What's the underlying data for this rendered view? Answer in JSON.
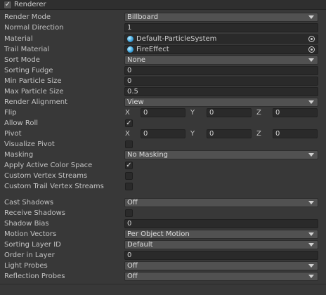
{
  "header": {
    "title": "Renderer",
    "enabled": "✓"
  },
  "fields": {
    "render_mode": {
      "label": "Render Mode",
      "value": "Billboard"
    },
    "normal_direction": {
      "label": "Normal Direction",
      "value": "1"
    },
    "material": {
      "label": "Material",
      "value": "Default-ParticleSystem"
    },
    "trail_material": {
      "label": "Trail Material",
      "value": "FireEffect"
    },
    "sort_mode": {
      "label": "Sort Mode",
      "value": "None"
    },
    "sorting_fudge": {
      "label": "Sorting Fudge",
      "value": "0"
    },
    "min_particle_size": {
      "label": "Min Particle Size",
      "value": "0"
    },
    "max_particle_size": {
      "label": "Max Particle Size",
      "value": "0.5"
    },
    "render_alignment": {
      "label": "Render Alignment",
      "value": "View"
    },
    "flip": {
      "label": "Flip",
      "x_label": "X",
      "x": "0",
      "y_label": "Y",
      "y": "0",
      "z_label": "Z",
      "z": "0"
    },
    "allow_roll": {
      "label": "Allow Roll",
      "checked": "✓"
    },
    "pivot": {
      "label": "Pivot",
      "x_label": "X",
      "x": "0",
      "y_label": "Y",
      "y": "0",
      "z_label": "Z",
      "z": "0"
    },
    "visualize_pivot": {
      "label": "Visualize Pivot",
      "checked": ""
    },
    "masking": {
      "label": "Masking",
      "value": "No Masking"
    },
    "apply_active_color_space": {
      "label": "Apply Active Color Space",
      "checked": "✓"
    },
    "custom_vertex_streams": {
      "label": "Custom Vertex Streams",
      "checked": ""
    },
    "custom_trail_vertex_streams": {
      "label": "Custom Trail Vertex Streams",
      "checked": ""
    },
    "cast_shadows": {
      "label": "Cast Shadows",
      "value": "Off"
    },
    "receive_shadows": {
      "label": "Receive Shadows",
      "checked": ""
    },
    "shadow_bias": {
      "label": "Shadow Bias",
      "value": "0"
    },
    "motion_vectors": {
      "label": "Motion Vectors",
      "value": "Per Object Motion"
    },
    "sorting_layer_id": {
      "label": "Sorting Layer ID",
      "value": "Default"
    },
    "order_in_layer": {
      "label": "Order in Layer",
      "value": "0"
    },
    "light_probes": {
      "label": "Light Probes",
      "value": "Off"
    },
    "reflection_probes": {
      "label": "Reflection Probes",
      "value": "Off"
    }
  }
}
